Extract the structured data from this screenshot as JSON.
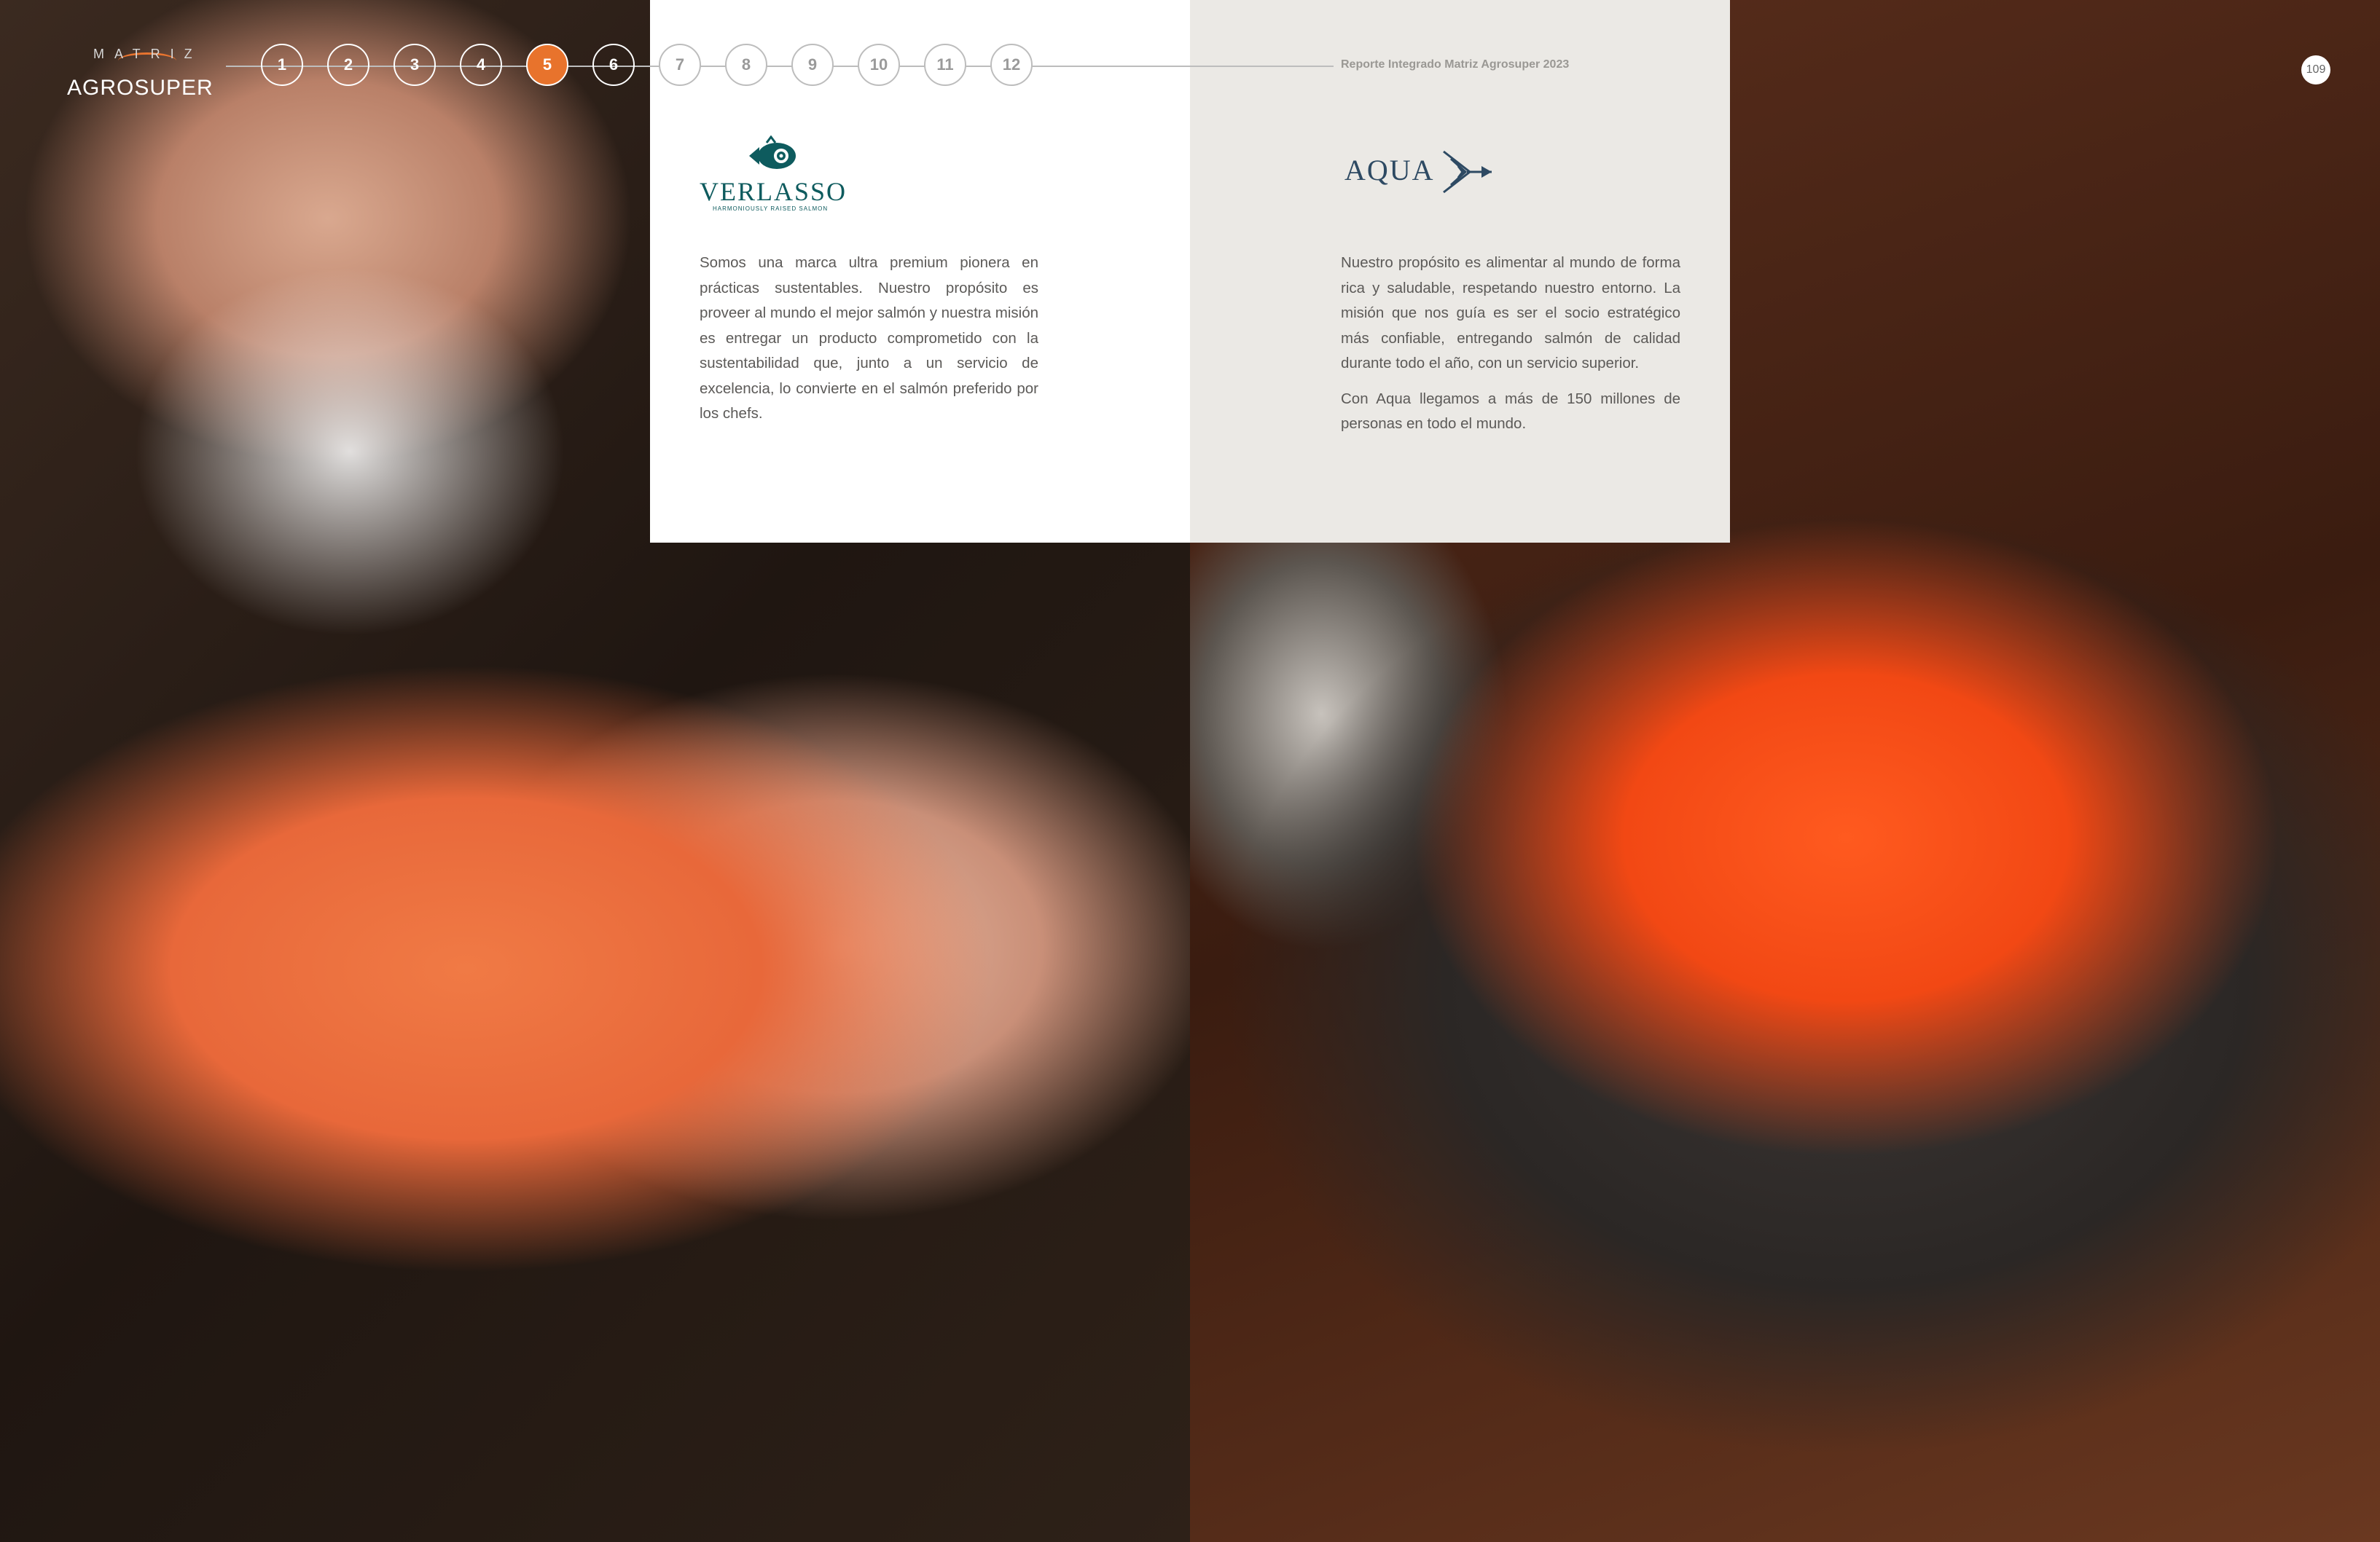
{
  "header": {
    "logo_top": "MATRIZ",
    "logo_bottom": "AGROSUPER",
    "report_title": "Reporte Integrado Matriz Agrosuper 2023",
    "page_number": "109"
  },
  "nav": {
    "steps": [
      "1",
      "2",
      "3",
      "4",
      "5",
      "6",
      "7",
      "8",
      "9",
      "10",
      "11",
      "12"
    ],
    "active": "5"
  },
  "verlasso": {
    "logo_word": "VERLASSO",
    "logo_tagline": "HARMONIOUSLY RAISED SALMON",
    "text": "Somos una marca ultra premium pionera en prácticas sustentables. Nuestro propósito es proveer al mundo el mejor salmón y nuestra misión es entregar un producto comprometido con la sustentabilidad que, junto a un servicio de excelencia, lo convierte en el salmón preferido por los chefs."
  },
  "aqua": {
    "logo_word": "AQUA",
    "text_1": "Nuestro propósito es alimentar al mundo de forma rica y saludable, respetando nuestro entorno. La misión que nos guía es ser el socio estratégico más confiable, entregando salmón de calidad durante todo el año, con un servicio superior.",
    "text_2": "Con Aqua llegamos a más de 150 millones de personas en todo el mundo."
  },
  "colors": {
    "accent": "#e8732c",
    "verlasso_teal": "#0e5b5e",
    "aqua_navy": "#2e4a63",
    "panel_right_bg": "#ebe9e5"
  }
}
